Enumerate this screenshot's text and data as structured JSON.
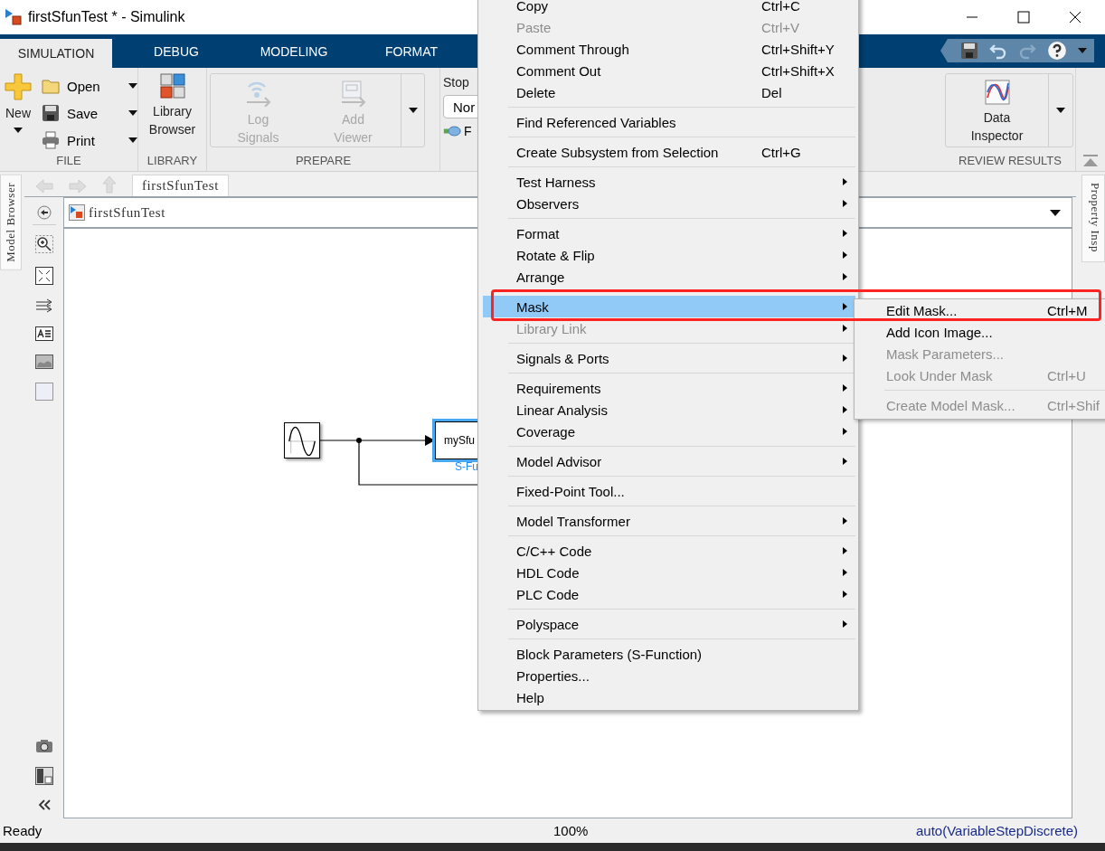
{
  "window": {
    "title": "firstSfunTest * - Simulink"
  },
  "ribbon_tabs": [
    {
      "label": "SIMULATION",
      "selected": true
    },
    {
      "label": "DEBUG",
      "selected": false
    },
    {
      "label": "MODELING",
      "selected": false
    },
    {
      "label": "FORMAT",
      "selected": false
    }
  ],
  "ribbon": {
    "file": {
      "label": "FILE",
      "new": "New",
      "open": "Open",
      "save": "Save",
      "print": "Print"
    },
    "library": {
      "label": "LIBRARY",
      "button_lines": [
        "Library",
        "Browser"
      ]
    },
    "prepare": {
      "label": "PREPARE",
      "buttons": [
        {
          "lines": [
            "Log",
            "Signals"
          ],
          "disabled": true
        },
        {
          "lines": [
            "Add",
            "Viewer"
          ],
          "disabled": true
        }
      ]
    },
    "simulate": {
      "stop_label": "Stop",
      "mode_field": "Nor",
      "fast_restart": "F"
    },
    "review": {
      "label": "REVIEW RESULTS",
      "button_lines": [
        "Data",
        "Inspector"
      ]
    }
  },
  "breadcrumb": {
    "tab": "firstSfunTest",
    "path": "firstSfunTest"
  },
  "side_tabs": {
    "left": "Model Browser",
    "right": "Property Insp"
  },
  "diagram": {
    "block_name": "mySfu",
    "block_label": "S-Fu",
    "block_selected": true
  },
  "context_menu": {
    "sections": [
      {
        "items": [
          {
            "label": "Copy",
            "shortcut": "Ctrl+C",
            "submenu": false,
            "disabled": false,
            "selected": false
          },
          {
            "label": "Paste",
            "shortcut": "Ctrl+V",
            "submenu": false,
            "disabled": true,
            "selected": false
          },
          {
            "label": "Comment Through",
            "shortcut": "Ctrl+Shift+Y",
            "submenu": false,
            "disabled": false,
            "selected": false
          },
          {
            "label": "Comment Out",
            "shortcut": "Ctrl+Shift+X",
            "submenu": false,
            "disabled": false,
            "selected": false
          },
          {
            "label": "Delete",
            "shortcut": "Del",
            "submenu": false,
            "disabled": false,
            "selected": false
          }
        ]
      },
      {
        "items": [
          {
            "label": "Find Referenced Variables",
            "submenu": false,
            "disabled": false,
            "selected": false
          }
        ]
      },
      {
        "items": [
          {
            "label": "Create Subsystem from Selection",
            "shortcut": "Ctrl+G",
            "submenu": false,
            "disabled": false,
            "selected": false
          }
        ]
      },
      {
        "items": [
          {
            "label": "Test Harness",
            "submenu": true,
            "disabled": false,
            "selected": false
          },
          {
            "label": "Observers",
            "submenu": true,
            "disabled": false,
            "selected": false
          }
        ]
      },
      {
        "items": [
          {
            "label": "Format",
            "submenu": true,
            "disabled": false,
            "selected": false
          },
          {
            "label": "Rotate & Flip",
            "submenu": true,
            "disabled": false,
            "selected": false
          },
          {
            "label": "Arrange",
            "submenu": true,
            "disabled": false,
            "selected": false
          }
        ]
      },
      {
        "items": [
          {
            "label": "Mask",
            "submenu": true,
            "disabled": false,
            "selected": true
          },
          {
            "label": "Library Link",
            "submenu": true,
            "disabled": true,
            "selected": false
          }
        ]
      },
      {
        "items": [
          {
            "label": "Signals & Ports",
            "submenu": true,
            "disabled": false,
            "selected": false
          }
        ]
      },
      {
        "items": [
          {
            "label": "Requirements",
            "submenu": true,
            "disabled": false,
            "selected": false
          },
          {
            "label": "Linear Analysis",
            "submenu": true,
            "disabled": false,
            "selected": false
          },
          {
            "label": "Coverage",
            "submenu": true,
            "disabled": false,
            "selected": false
          }
        ]
      },
      {
        "items": [
          {
            "label": "Model Advisor",
            "submenu": true,
            "disabled": false,
            "selected": false
          }
        ]
      },
      {
        "items": [
          {
            "label": "Fixed-Point Tool...",
            "submenu": false,
            "disabled": false,
            "selected": false
          }
        ]
      },
      {
        "items": [
          {
            "label": "Model Transformer",
            "submenu": true,
            "disabled": false,
            "selected": false
          }
        ]
      },
      {
        "items": [
          {
            "label": "C/C++ Code",
            "submenu": true,
            "disabled": false,
            "selected": false
          },
          {
            "label": "HDL Code",
            "submenu": true,
            "disabled": false,
            "selected": false
          },
          {
            "label": "PLC Code",
            "submenu": true,
            "disabled": false,
            "selected": false
          }
        ]
      },
      {
        "items": [
          {
            "label": "Polyspace",
            "submenu": true,
            "disabled": false,
            "selected": false
          }
        ]
      },
      {
        "items": [
          {
            "label": "Block Parameters (S-Function)",
            "submenu": false,
            "disabled": false,
            "selected": false
          },
          {
            "label": "Properties...",
            "submenu": false,
            "disabled": false,
            "selected": false
          },
          {
            "label": "Help",
            "submenu": false,
            "disabled": false,
            "selected": false
          }
        ]
      }
    ]
  },
  "submenu": {
    "sections": [
      {
        "items": [
          {
            "label": "Edit Mask...",
            "shortcut": "Ctrl+M",
            "disabled": false
          },
          {
            "label": "Add Icon Image...",
            "disabled": false
          },
          {
            "label": "Mask Parameters...",
            "disabled": true
          },
          {
            "label": "Look Under Mask",
            "shortcut": "Ctrl+U",
            "disabled": true
          }
        ]
      },
      {
        "items": [
          {
            "label": "Create Model Mask...",
            "shortcut": "Ctrl+Shif",
            "disabled": true
          }
        ]
      }
    ]
  },
  "status_bar": {
    "status": "Ready",
    "zoom": "100%",
    "solver": "auto(VariableStepDiscrete)"
  }
}
